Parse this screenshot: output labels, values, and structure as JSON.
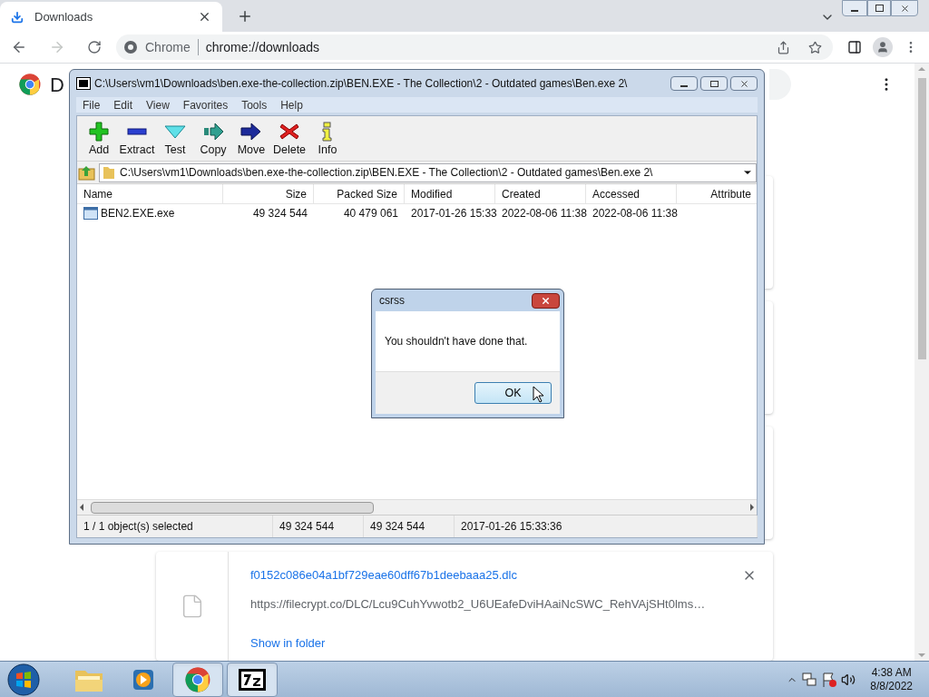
{
  "browser": {
    "tab": {
      "title": "Downloads"
    },
    "address": {
      "site": "Chrome",
      "url": "chrome://downloads"
    }
  },
  "downloads_page": {
    "heading": "D",
    "cards": [
      {
        "kind": "hidden"
      },
      {
        "kind": "hidden"
      },
      {
        "kind": "hidden"
      },
      {
        "kind": "file",
        "name": "f0152c086e04a1bf729eae60dff67b1deebaaa25.dlc",
        "url": "https://filecrypt.co/DLC/Lcu9CuhYvwotb2_U6UEafeDviHAaiNcSWC_RehVAjSHt0lms…",
        "action": "Show in folder"
      }
    ]
  },
  "archive_window": {
    "title": "C:\\Users\\vm1\\Downloads\\ben.exe-the-collection.zip\\BEN.EXE - The Collection\\2 - Outdated games\\Ben.exe 2\\",
    "menu": [
      "File",
      "Edit",
      "View",
      "Favorites",
      "Tools",
      "Help"
    ],
    "toolbar": [
      {
        "kind": "add",
        "label": "Add"
      },
      {
        "kind": "extract",
        "label": "Extract"
      },
      {
        "kind": "test",
        "label": "Test"
      },
      {
        "kind": "copy",
        "label": "Copy"
      },
      {
        "kind": "move",
        "label": "Move"
      },
      {
        "kind": "delete",
        "label": "Delete"
      },
      {
        "kind": "info",
        "label": "Info"
      }
    ],
    "path": "C:\\Users\\vm1\\Downloads\\ben.exe-the-collection.zip\\BEN.EXE - The Collection\\2 - Outdated games\\Ben.exe 2\\",
    "columns": [
      "Name",
      "Size",
      "Packed Size",
      "Modified",
      "Created",
      "Accessed",
      "Attribute"
    ],
    "rows": [
      {
        "cells": [
          "BEN2.EXE.exe",
          "49 324 544",
          "40 479 061",
          "2017-01-26 15:33",
          "2022-08-06 11:38",
          "2022-08-06 11:38"
        ]
      }
    ],
    "status": [
      "1 / 1 object(s) selected",
      "49 324 544",
      "49 324 544",
      "2017-01-26 15:33:36"
    ]
  },
  "dialog": {
    "title": "csrss",
    "message": "You shouldn't have done that.",
    "button": "OK"
  },
  "taskbar": {
    "apps": [
      {
        "kind": "explorer",
        "running": false
      },
      {
        "kind": "media",
        "running": false
      },
      {
        "kind": "chrome",
        "running": true
      },
      {
        "kind": "archiver",
        "running": true
      }
    ],
    "time": "4:38 AM",
    "date": "8/8/2022"
  }
}
